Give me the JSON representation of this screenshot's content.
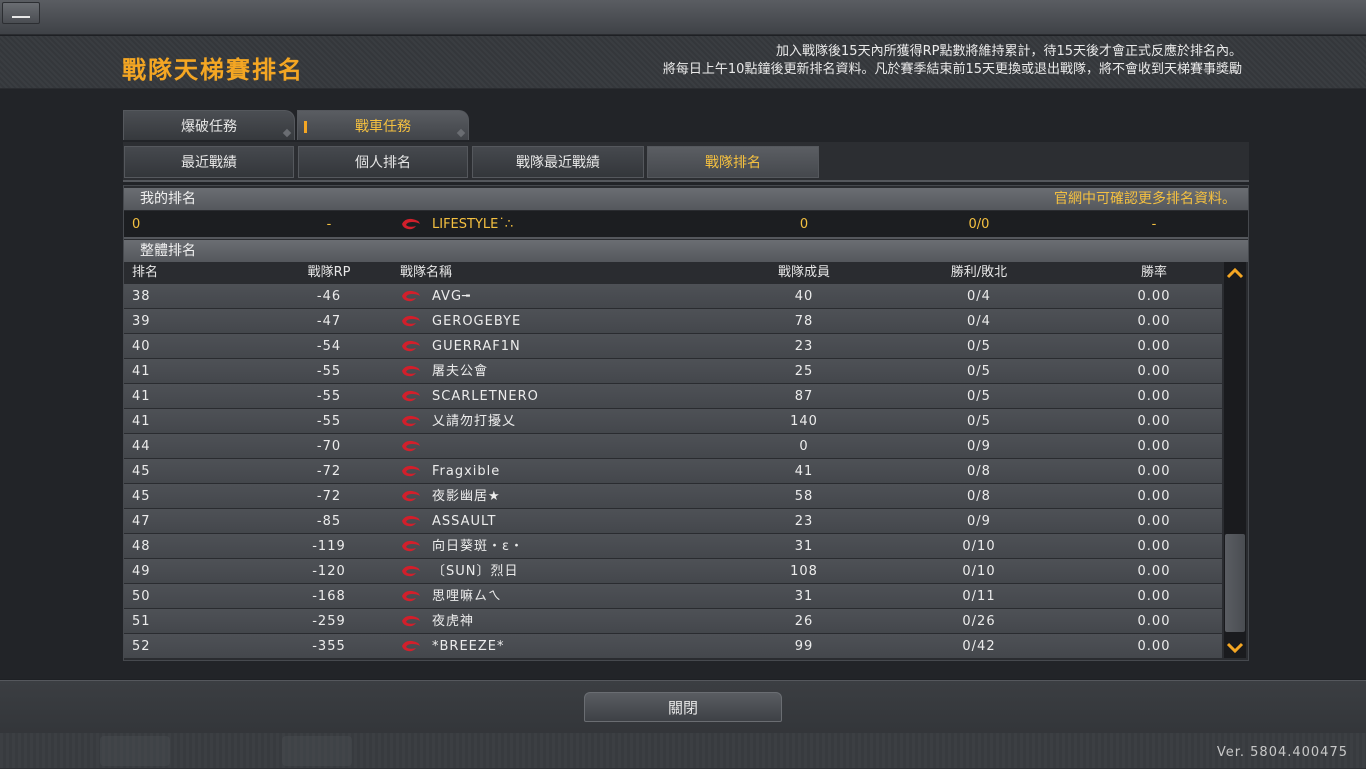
{
  "header": {
    "title": "戰隊天梯賽排名",
    "notice_line1": "加入戰隊後15天內所獲得RP點數將維持累計，待15天後才會正式反應於排名內。",
    "notice_line2": "將每日上午10點鐘後更新排名資料。凡於賽季結束前15天更換或退出戰隊，將不會收到天梯賽事獎勵"
  },
  "tabs": [
    {
      "label": "爆破任務",
      "active": false
    },
    {
      "label": "戰車任務",
      "active": true
    }
  ],
  "subtabs": [
    {
      "label": "最近戰績",
      "active": false
    },
    {
      "label": "個人排名",
      "active": false
    },
    {
      "label": "戰隊最近戰績",
      "active": false
    },
    {
      "label": "戰隊排名",
      "active": true
    }
  ],
  "my_ranking": {
    "section_label": "我的排名",
    "link": "官網中可確認更多排名資料。",
    "rank": "0",
    "rp": "-",
    "name": "LIFESTYLE˙∴",
    "members": "0",
    "win_loss": "0/0",
    "rate": "-"
  },
  "overall": {
    "section_label": "整體排名",
    "columns": {
      "rank": "排名",
      "rp": "戰隊RP",
      "name": "戰隊名稱",
      "members": "戰隊成員",
      "win_loss": "勝利/敗北",
      "rate": "勝率"
    },
    "rows": [
      {
        "rank": "38",
        "rp": "-46",
        "name": "AVG╼",
        "members": "40",
        "win_loss": "0/4",
        "rate": "0.00"
      },
      {
        "rank": "39",
        "rp": "-47",
        "name": "GEROGEBYE",
        "members": "78",
        "win_loss": "0/4",
        "rate": "0.00"
      },
      {
        "rank": "40",
        "rp": "-54",
        "name": "GUERRAF1N",
        "members": "23",
        "win_loss": "0/5",
        "rate": "0.00"
      },
      {
        "rank": "41",
        "rp": "-55",
        "name": "屠夫公會",
        "members": "25",
        "win_loss": "0/5",
        "rate": "0.00"
      },
      {
        "rank": "41",
        "rp": "-55",
        "name": "SCARLETNERO",
        "members": "87",
        "win_loss": "0/5",
        "rate": "0.00"
      },
      {
        "rank": "41",
        "rp": "-55",
        "name": "乂請勿打擾乂",
        "members": "140",
        "win_loss": "0/5",
        "rate": "0.00"
      },
      {
        "rank": "44",
        "rp": "-70",
        "name": "",
        "members": "0",
        "win_loss": "0/9",
        "rate": "0.00"
      },
      {
        "rank": "45",
        "rp": "-72",
        "name": "Fragxible",
        "members": "41",
        "win_loss": "0/8",
        "rate": "0.00"
      },
      {
        "rank": "45",
        "rp": "-72",
        "name": "夜影幽居★",
        "members": "58",
        "win_loss": "0/8",
        "rate": "0.00"
      },
      {
        "rank": "47",
        "rp": "-85",
        "name": "ASSAULT",
        "members": "23",
        "win_loss": "0/9",
        "rate": "0.00"
      },
      {
        "rank": "48",
        "rp": "-119",
        "name": "向日葵斑・ε・",
        "members": "31",
        "win_loss": "0/10",
        "rate": "0.00"
      },
      {
        "rank": "49",
        "rp": "-120",
        "name": "〔SUN〕烈日",
        "members": "108",
        "win_loss": "0/10",
        "rate": "0.00"
      },
      {
        "rank": "50",
        "rp": "-168",
        "name": "思哩嘛ㄙㄟ",
        "members": "31",
        "win_loss": "0/11",
        "rate": "0.00"
      },
      {
        "rank": "51",
        "rp": "-259",
        "name": "夜虎神",
        "members": "26",
        "win_loss": "0/26",
        "rate": "0.00"
      },
      {
        "rank": "52",
        "rp": "-355",
        "name": "*BREEZE*",
        "members": "99",
        "win_loss": "0/42",
        "rate": "0.00"
      }
    ]
  },
  "footer": {
    "close_label": "關閉",
    "version": "Ver. 5804.400475"
  },
  "colors": {
    "accent": "#f4a623",
    "highlight": "#f4c040",
    "emblem_red": "#d21f2b"
  },
  "icons": [
    "clan-emblem-icon",
    "scroll-up-icon",
    "scroll-down-icon",
    "minimize-icon"
  ]
}
